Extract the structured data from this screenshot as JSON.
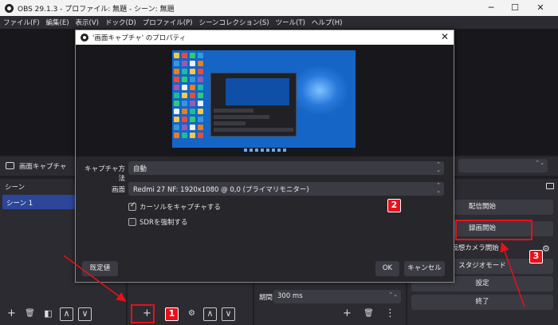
{
  "window": {
    "title": "OBS 29.1.3 - プロファイル: 無題 - シーン: 無題",
    "minimize": "─",
    "maximize": "☐",
    "close": "✕"
  },
  "menu": [
    "ファイル(F)",
    "編集(E)",
    "表示(V)",
    "ドック(D)",
    "プロファイル(P)",
    "シーンコレクション(S)",
    "ツール(T)",
    "ヘルプ(H)"
  ],
  "source_bar": {
    "label": "画面キャプチャ"
  },
  "scenes_dock": {
    "title": "シーン",
    "items": [
      "シーン 1"
    ]
  },
  "transition": {
    "duration_label": "期間",
    "duration_value": "300 ms"
  },
  "controls": {
    "start_streaming": "配信開始",
    "start_recording": "録画開始",
    "virtual_camera": "仮想カメラ開始",
    "studio_mode": "スタジオモード",
    "settings": "設定",
    "exit": "終了"
  },
  "dialog": {
    "title": "'画面キャプチャ' のプロパティ",
    "close": "✕",
    "capture_method_label": "キャプチャ方法",
    "capture_method_value": "自動",
    "display_label": "画面",
    "display_value": "Redmi 27 NF: 1920x1080 @ 0,0 (プライマリモニター)",
    "capture_cursor_label": "カーソルをキャプチャする",
    "capture_cursor_checked": true,
    "force_sdr_label": "SDRを強制する",
    "force_sdr_checked": false,
    "defaults_button": "既定値",
    "ok_button": "OK",
    "cancel_button": "キャンセル"
  },
  "annotations": {
    "badge1": "1",
    "badge2": "2",
    "badge3": "3",
    "color": "#e8101a"
  },
  "toolbar_icons": {
    "add": "+",
    "remove": "🗑",
    "filter": "◧",
    "up": "∧",
    "down": "∨",
    "more": "⋮"
  }
}
